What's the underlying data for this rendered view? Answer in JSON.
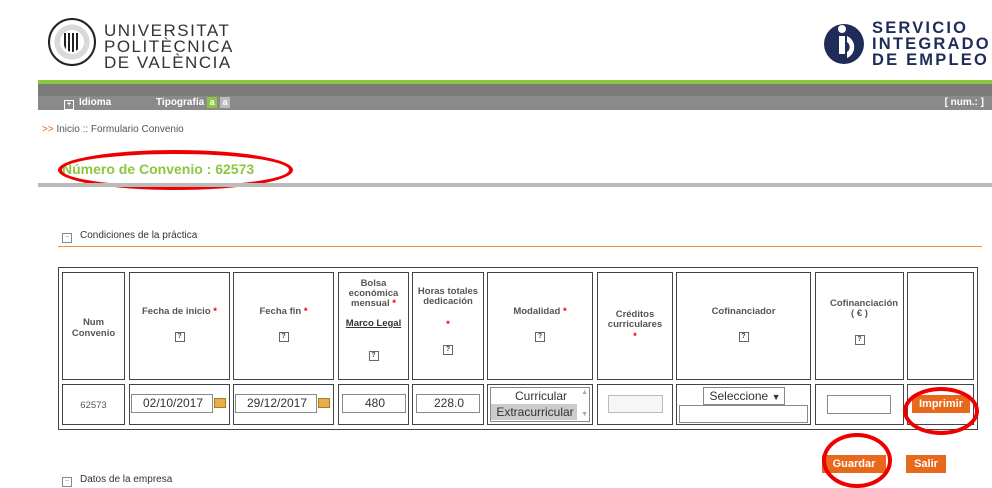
{
  "header": {
    "upv_lines": [
      "UNIVERSITAT",
      "POLITÈCNICA",
      "DE VALÈNCIA"
    ],
    "sie_lines": [
      "SERVICIO",
      "INTEGRADO",
      "DE EMPLEO"
    ]
  },
  "menu": {
    "idioma": "Idioma",
    "tipografia": "Tipografía",
    "typo_big": "a",
    "typo_small": "a",
    "num": "[ num.: ]"
  },
  "breadcrumb": {
    "arrow": ">>",
    "text": "Inicio :: Formulario Convenio"
  },
  "convenio": {
    "title": "Número de Convenio : 62573"
  },
  "section_conditions": "Condiciones de la práctica",
  "section_company": "Datos de la empresa",
  "table": {
    "headers": {
      "num": "Num Convenio",
      "fecha_inicio": "Fecha de inicio",
      "fecha_fin": "Fecha fin",
      "bolsa": "Bolsa económica mensual",
      "marco": "Marco Legal",
      "horas": "Horas totales dedicación",
      "modalidad": "Modalidad",
      "creditos": "Créditos curriculares",
      "cofinanciador": "Cofinanciador",
      "cofinanciacion": "Cofinanciación ( € )"
    },
    "required_mark": "*",
    "help_mark": "?",
    "row": {
      "num": "62573",
      "fecha_inicio": "02/10/2017",
      "fecha_fin": "29/12/2017",
      "bolsa": "480",
      "horas": "228.0",
      "modalidad_options": [
        "Curricular",
        "Extracurricular"
      ],
      "modalidad_selected": "Extracurricular",
      "creditos": "",
      "cofinanciador": "Seleccione",
      "cofinanciacion": ""
    }
  },
  "buttons": {
    "imprimir": "Imprimir",
    "guardar": "Guardar",
    "salir": "Salir"
  },
  "colors": {
    "accent_green": "#8dc63f",
    "accent_orange": "#e8681c",
    "highlight_red": "#e00000"
  }
}
